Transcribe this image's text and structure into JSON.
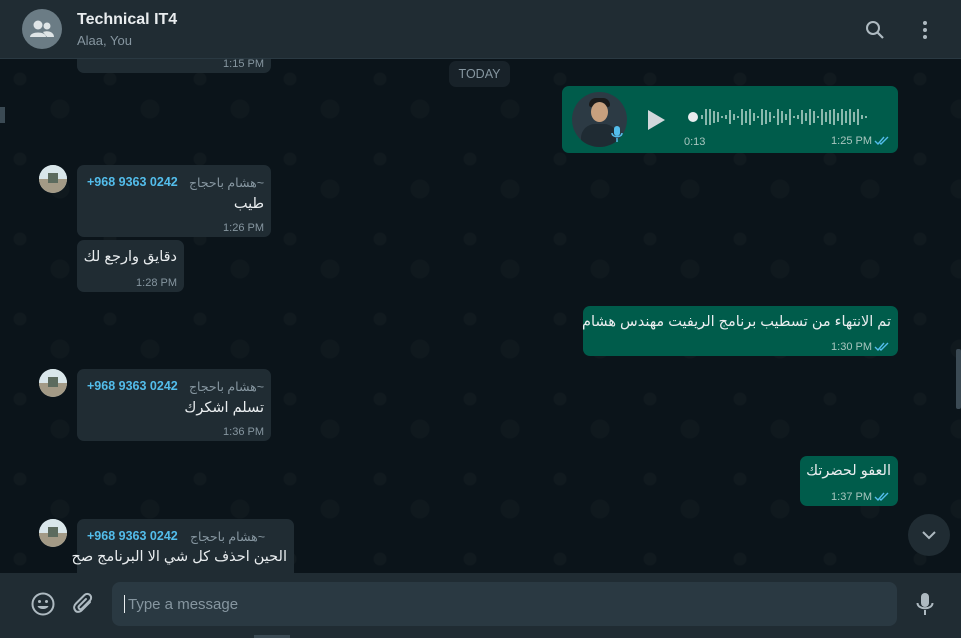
{
  "header": {
    "title": "Technical IT4",
    "subtitle": "Alaa, You",
    "icons": [
      "group-icon",
      "search-icon",
      "menu-icon"
    ]
  },
  "colors": {
    "incoming": "#202c33",
    "outgoing": "#005c4b",
    "background": "#0b141a",
    "phone": "#53bdeb",
    "read_ticks": "#53bdeb"
  },
  "chat": {
    "partial_top_time": "1:15 PM",
    "date_divider": "TODAY",
    "voice": {
      "duration": "0:13",
      "time": "1:25 PM",
      "status": "read"
    },
    "messages": [
      {
        "sender_name": "~هشام باحجاج",
        "sender_phone": "+968 9363 0242",
        "text": "طيب",
        "time": "1:26 PM"
      },
      {
        "text": "دقايق وارجع لك",
        "time": "1:28 PM"
      },
      {
        "text": "تم الانتهاء من تسطيب برنامج الريفيت مهندس هشام",
        "time": "1:30 PM",
        "status": "read"
      },
      {
        "sender_name": "~هشام باحجاج",
        "sender_phone": "+968 9363 0242",
        "text": "تسلم اشكرك",
        "time": "1:36 PM"
      },
      {
        "text": "العفو لحضرتك",
        "time": "1:37 PM",
        "status": "read"
      },
      {
        "sender_name": "~هشام باحجاج",
        "sender_phone": "+968 9363 0242",
        "text": "الحين احذف كل شي الا البرنامج صح"
      }
    ]
  },
  "composer": {
    "placeholder": "Type a message"
  }
}
